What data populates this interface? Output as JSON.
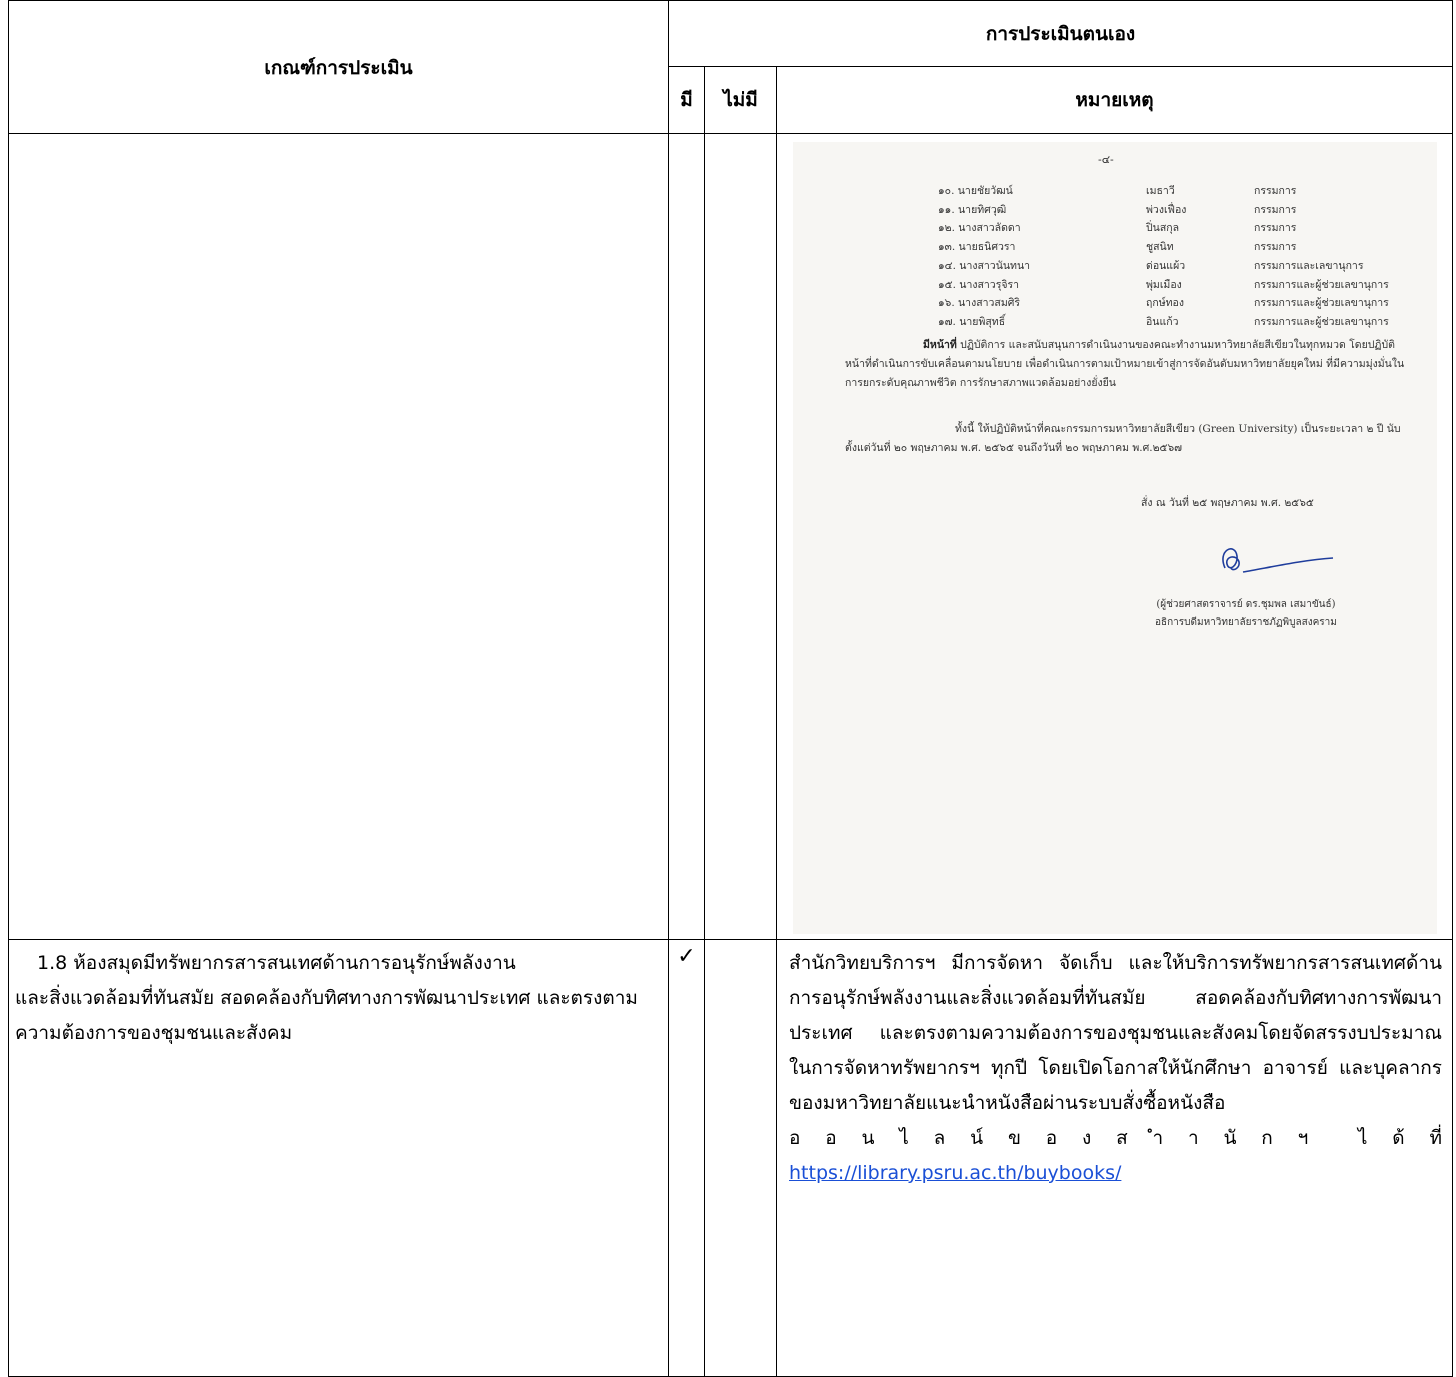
{
  "header": {
    "criteria": "เกณฑ์การประเมิน",
    "self_assessment": "การประเมินตนเอง",
    "have": "มี",
    "not_have": "ไม่มี",
    "remark": "หมายเหตุ"
  },
  "scanned_doc": {
    "page_number": "-๔-",
    "members": [
      {
        "name": "๑๐. นายชัยวัฒน์",
        "surname": "เมธาวี",
        "role": "กรรมการ"
      },
      {
        "name": "๑๑. นายทิศวุฒิ",
        "surname": "พ่วงเฟื่อง",
        "role": "กรรมการ"
      },
      {
        "name": "๑๒. นางสาวลัดดา",
        "surname": "ปิ่นสกุล",
        "role": "กรรมการ"
      },
      {
        "name": "๑๓. นายธนิศวรา",
        "surname": "ชูสนิท",
        "role": "กรรมการ"
      },
      {
        "name": "๑๔. นางสาวนันทนา",
        "surname": "ด่อนแผ้ว",
        "role": "กรรมการและเลขานุการ"
      },
      {
        "name": "๑๕. นางสาวรุจิรา",
        "surname": "พุ่มเมือง",
        "role": "กรรมการและผู้ช่วยเลขานุการ"
      },
      {
        "name": "๑๖. นางสาวสมศิริ",
        "surname": "ฤกษ์ทอง",
        "role": "กรรมการและผู้ช่วยเลขานุการ"
      },
      {
        "name": "๑๗. นายพิสุทธิ์",
        "surname": "อินแก้ว",
        "role": "กรรมการและผู้ช่วยเลขานุการ"
      }
    ],
    "duty_label": "มีหน้าที่",
    "duty_text": " ปฏิบัติการ และสนับสนุนการดำเนินงานของคณะทำงานมหาวิทยาลัยสีเขียวในทุกหมวด โดยปฏิบัติหน้าที่ดำเนินการขับเคลื่อนตามนโยบาย เพื่อดำเนินการตามเป้าหมายเข้าสู่การจัดอันดับมหาวิทยาลัยยุคใหม่ ที่มีความมุ่งมั่นในการยกระดับคุณภาพชีวิต การรักษาสภาพแวดล้อมอย่างยั่งยืน",
    "term_text": "ทั้งนี้ ให้ปฏิบัติหน้าที่คณะกรรมการมหาวิทยาลัยสีเขียว (Green University) เป็นระยะเวลา ๒ ปี นับตั้งแต่วันที่ ๒๐ พฤษภาคม พ.ศ. ๒๕๖๕ จนถึงวันที่ ๒๐ พฤษภาคม พ.ศ.๒๕๖๗",
    "order_date": "สั่ง ณ วันที่ ๒๕ พฤษภาคม พ.ศ. ๒๕๖๕",
    "signer_name": "(ผู้ช่วยศาสตราจารย์ ดร.ชุมพล เสมาขันธ์)",
    "signer_title": "อธิการบดีมหาวิทยาลัยราชภัฏพิบูลสงคราม"
  },
  "row2": {
    "criteria_first": "1.8 ห้องสมุดมีทรัพยากรสารสนเทศด้านการอนุรักษ์พลังงาน",
    "criteria_rest": "และสิ่งแวดล้อมที่ทันสมัย สอดคล้องกับทิศทางการพัฒนาประเทศ และตรงตามความต้องการของชุมชนและสังคม",
    "check_mark": "✓",
    "remark": "สำนักวิทยบริการฯ มีการจัดหา จัดเก็บ และให้บริการทรัพยากรสารสนเทศด้านการอนุรักษ์พลังงานและสิ่งแวดล้อมที่ทันสมัย สอดคล้องกับทิศทางการพัฒนาประเทศ และตรงตามความต้องการของชุมชนและสังคมโดยจัดสรรงบประมาณในการจัดหาทรัพยากรฯ ทุกปี โดยเปิดโอกาสให้นักศึกษา อาจารย์ และบุคลากรของมหาวิทยาลัยแนะนำหนังสือผ่านระบบสั่งซื้อหนังสือ",
    "remark_spaced": [
      "อ",
      "อ",
      "น",
      "ไ",
      "ล",
      "น์",
      "ข",
      "อ",
      "ง",
      "ส",
      "ำ",
      "า",
      "นั",
      "ก",
      "ฯ",
      "",
      "ไ",
      "ด้",
      "ที่"
    ],
    "link": "https://library.psru.ac.th/buybooks/"
  }
}
